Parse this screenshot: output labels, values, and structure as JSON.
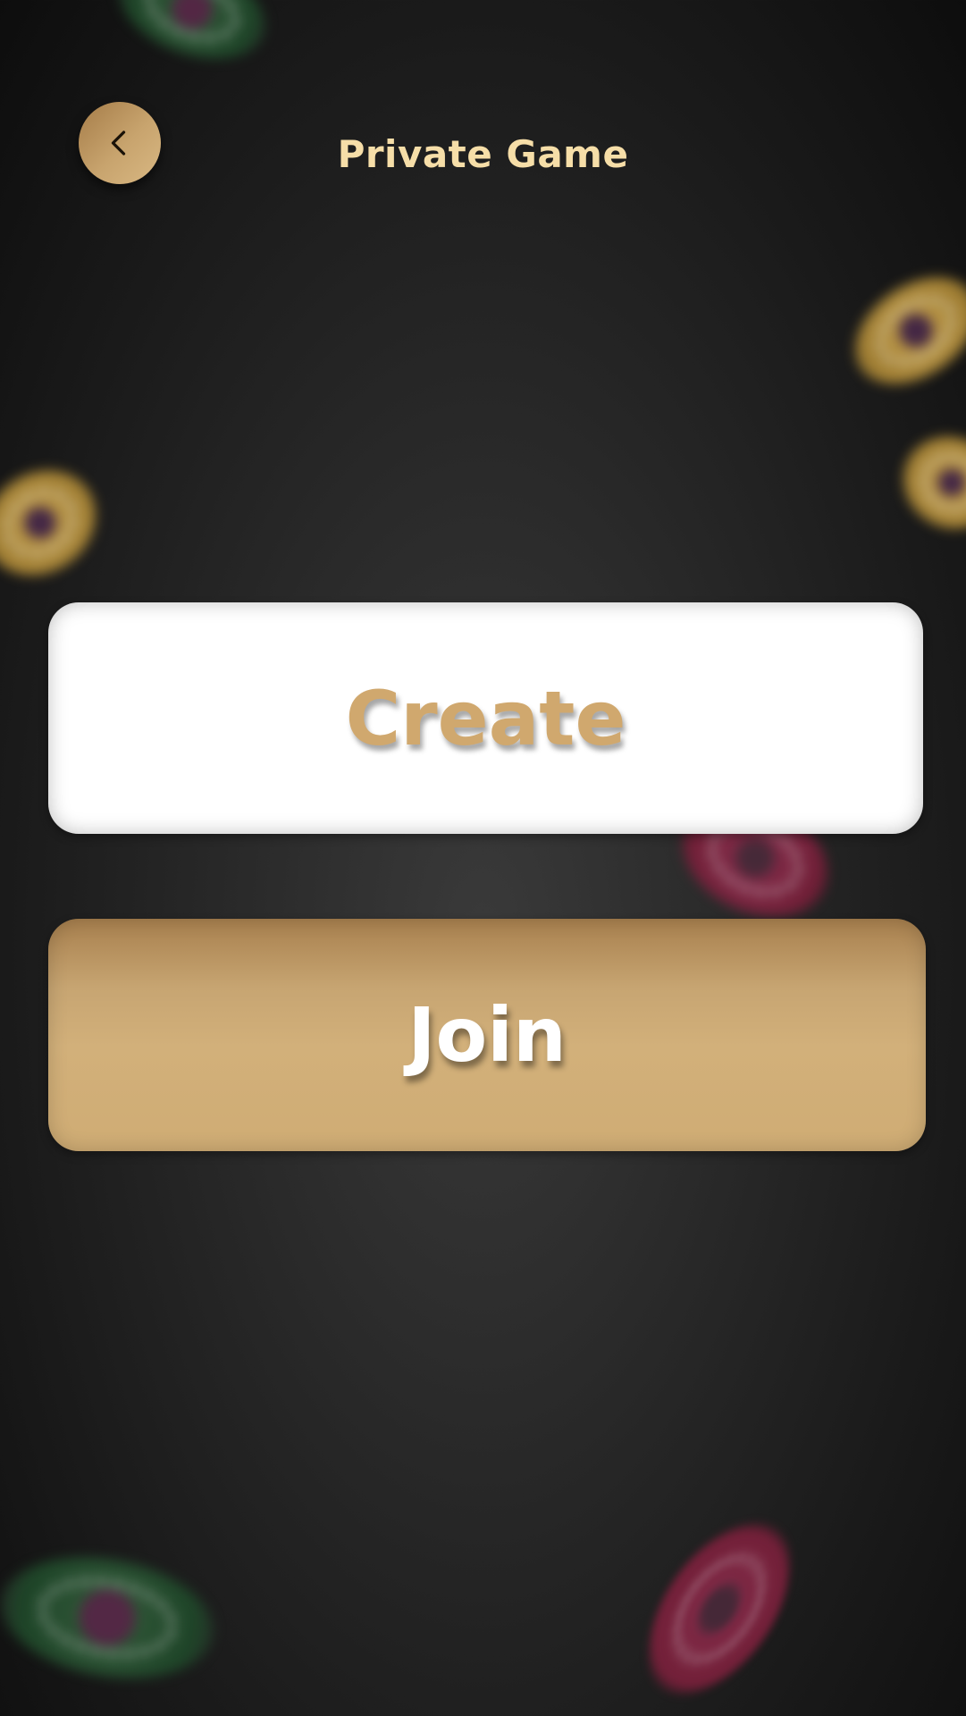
{
  "header": {
    "title": "Private Game",
    "back_icon": "chevron-left-icon"
  },
  "actions": {
    "create_label": "Create",
    "join_label": "Join"
  },
  "colors": {
    "title": "#f6dea8",
    "accent_gold": "#d0a86e",
    "background": "#1a1a1a"
  }
}
